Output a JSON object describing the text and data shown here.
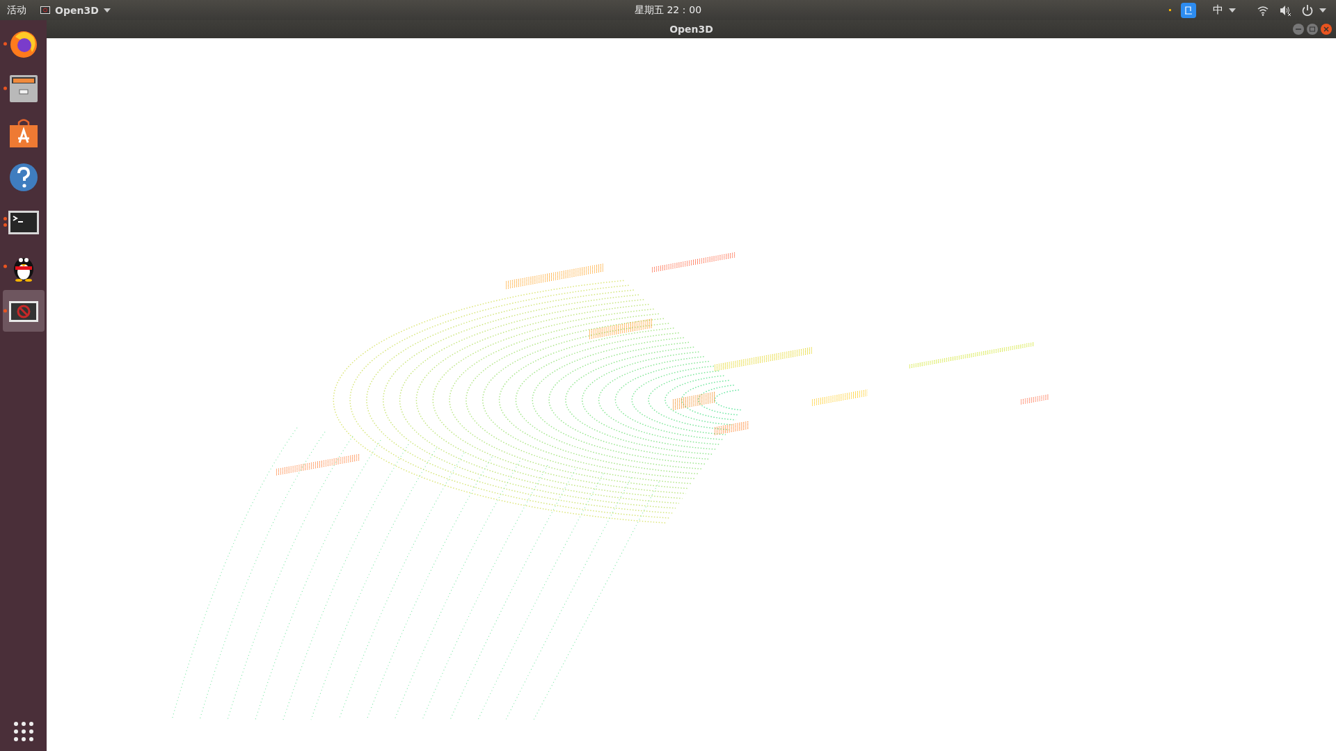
{
  "top_bar": {
    "activities": "活动",
    "app_menu": "Open3D",
    "clock": "星期五 22：00",
    "input_method": "中"
  },
  "dock": {
    "items": [
      {
        "kind": "browser",
        "running": true,
        "multi_window": false,
        "selected": false
      },
      {
        "kind": "files",
        "running": true,
        "multi_window": false,
        "selected": false
      },
      {
        "kind": "store",
        "running": false,
        "multi_window": false,
        "selected": false
      },
      {
        "kind": "help",
        "running": false,
        "multi_window": false,
        "selected": false
      },
      {
        "kind": "terminal",
        "running": true,
        "multi_window": true,
        "selected": false
      },
      {
        "kind": "penguin",
        "running": true,
        "multi_window": false,
        "selected": false
      },
      {
        "kind": "blocked",
        "running": true,
        "multi_window": false,
        "selected": true
      }
    ]
  },
  "window": {
    "title": "Open3D"
  }
}
